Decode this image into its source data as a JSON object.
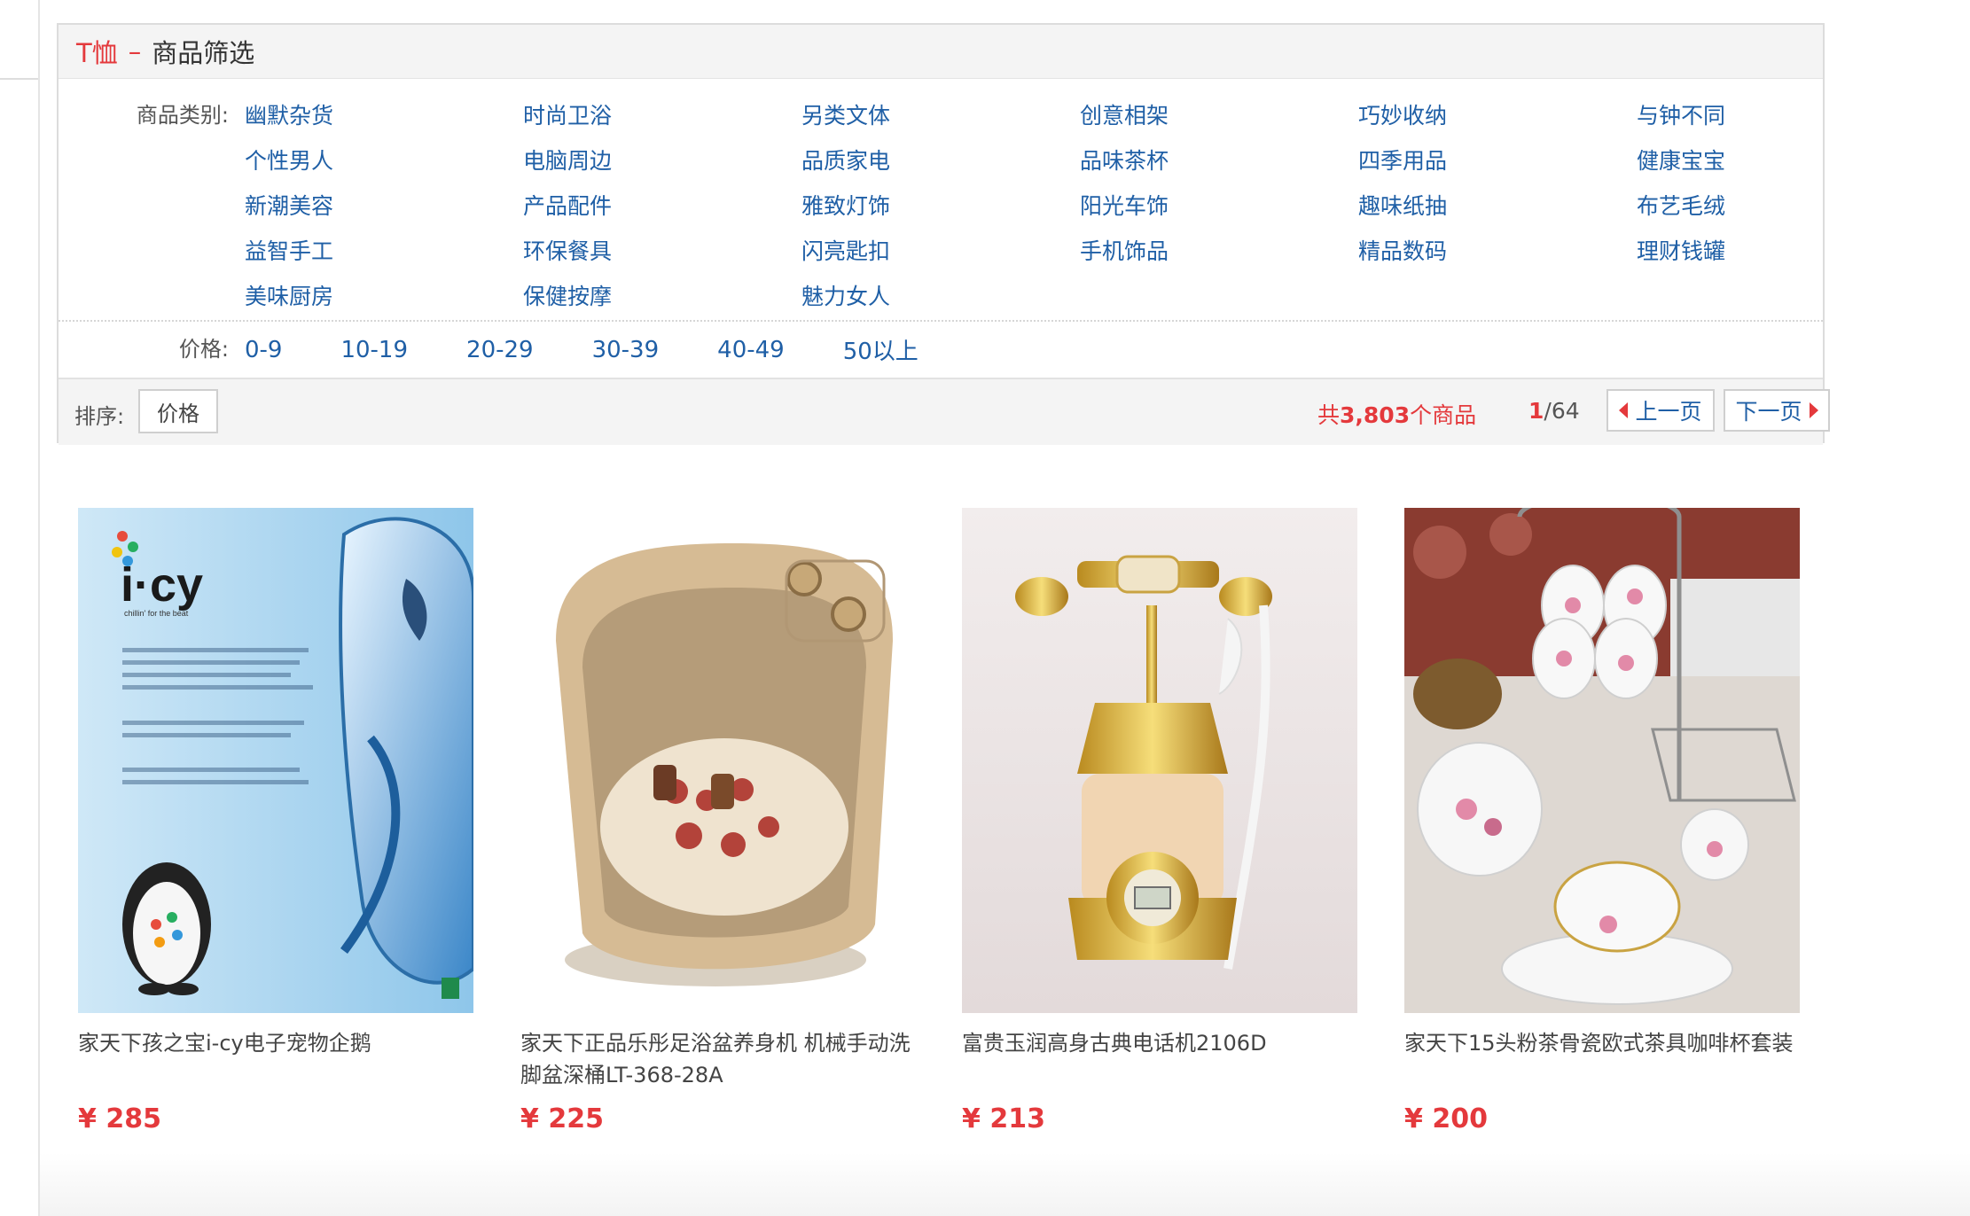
{
  "filter": {
    "header": {
      "category": "T恤",
      "separator": "–",
      "title": "商品筛选"
    },
    "category_label": "商品类别:",
    "categories": [
      "幽默杂货",
      "时尚卫浴",
      "另类文体",
      "创意相架",
      "巧妙收纳",
      "与钟不同",
      "个性男人",
      "电脑周边",
      "品质家电",
      "品味茶杯",
      "四季用品",
      "健康宝宝",
      "新潮美容",
      "产品配件",
      "雅致灯饰",
      "阳光车饰",
      "趣味纸抽",
      "布艺毛绒",
      "益智手工",
      "环保餐具",
      "闪亮匙扣",
      "手机饰品",
      "精品数码",
      "理财钱罐",
      "美味厨房",
      "保健按摩",
      "魅力女人"
    ],
    "price_label": "价格:",
    "prices": [
      "0-9",
      "10-19",
      "20-29",
      "30-39",
      "40-49",
      "50以上"
    ]
  },
  "sort": {
    "label": "排序:",
    "price_button": "价格",
    "total_prefix": "共",
    "total_count": "3,803",
    "total_suffix": "个商品",
    "page_current": "1",
    "page_total": "/64",
    "prev_label": "上一页",
    "next_label": "下一页"
  },
  "products": [
    {
      "name": "家天下孩之宝i-cy电子宠物企鹅",
      "price": "¥ 285",
      "image": "icy-penguin-toy",
      "image_text": {
        "brand": "i·cy",
        "tag": "chillin' for the beat"
      }
    },
    {
      "name": "家天下正品乐彤足浴盆养身机 机械手动洗脚盆深桶LT-368-28A",
      "price": "¥ 225",
      "image": "foot-bath-basin"
    },
    {
      "name": "富贵玉润高身古典电话机2106D",
      "price": "¥ 213",
      "image": "classic-telephone"
    },
    {
      "name": "家天下15头粉茶骨瓷欧式茶具咖啡杯套装",
      "price": "¥ 200",
      "image": "porcelain-tea-set"
    }
  ],
  "colors": {
    "accent": "#e4393c",
    "link": "#1f5fa6",
    "border": "#dcdcdc",
    "header_bg": "#f4f4f4"
  }
}
